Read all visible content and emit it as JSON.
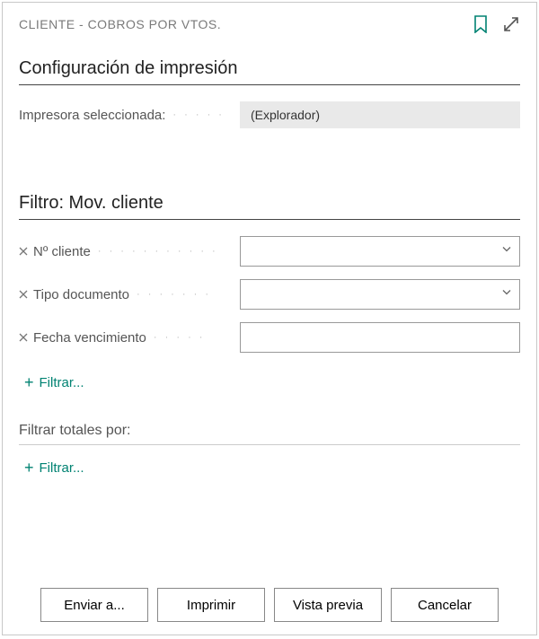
{
  "header": {
    "title": "CLIENTE - COBROS POR VTOS.",
    "bookmark_icon": "bookmark",
    "expand_icon": "expand"
  },
  "print_config": {
    "heading": "Configuración de impresión",
    "printer_label": "Impresora seleccionada:",
    "printer_value": "(Explorador)"
  },
  "filter_section": {
    "heading": "Filtro: Mov. cliente",
    "rows": [
      {
        "label": "Nº cliente",
        "value": "",
        "type": "select"
      },
      {
        "label": "Tipo documento",
        "value": "",
        "type": "select"
      },
      {
        "label": "Fecha vencimiento",
        "value": "",
        "type": "text"
      }
    ],
    "add_filter_label": "Filtrar..."
  },
  "totals_section": {
    "heading": "Filtrar totales por:",
    "add_filter_label": "Filtrar..."
  },
  "footer": {
    "send_to": "Enviar a...",
    "print": "Imprimir",
    "preview": "Vista previa",
    "cancel": "Cancelar"
  },
  "colors": {
    "accent": "#008272",
    "border": "#c8c8c8"
  }
}
